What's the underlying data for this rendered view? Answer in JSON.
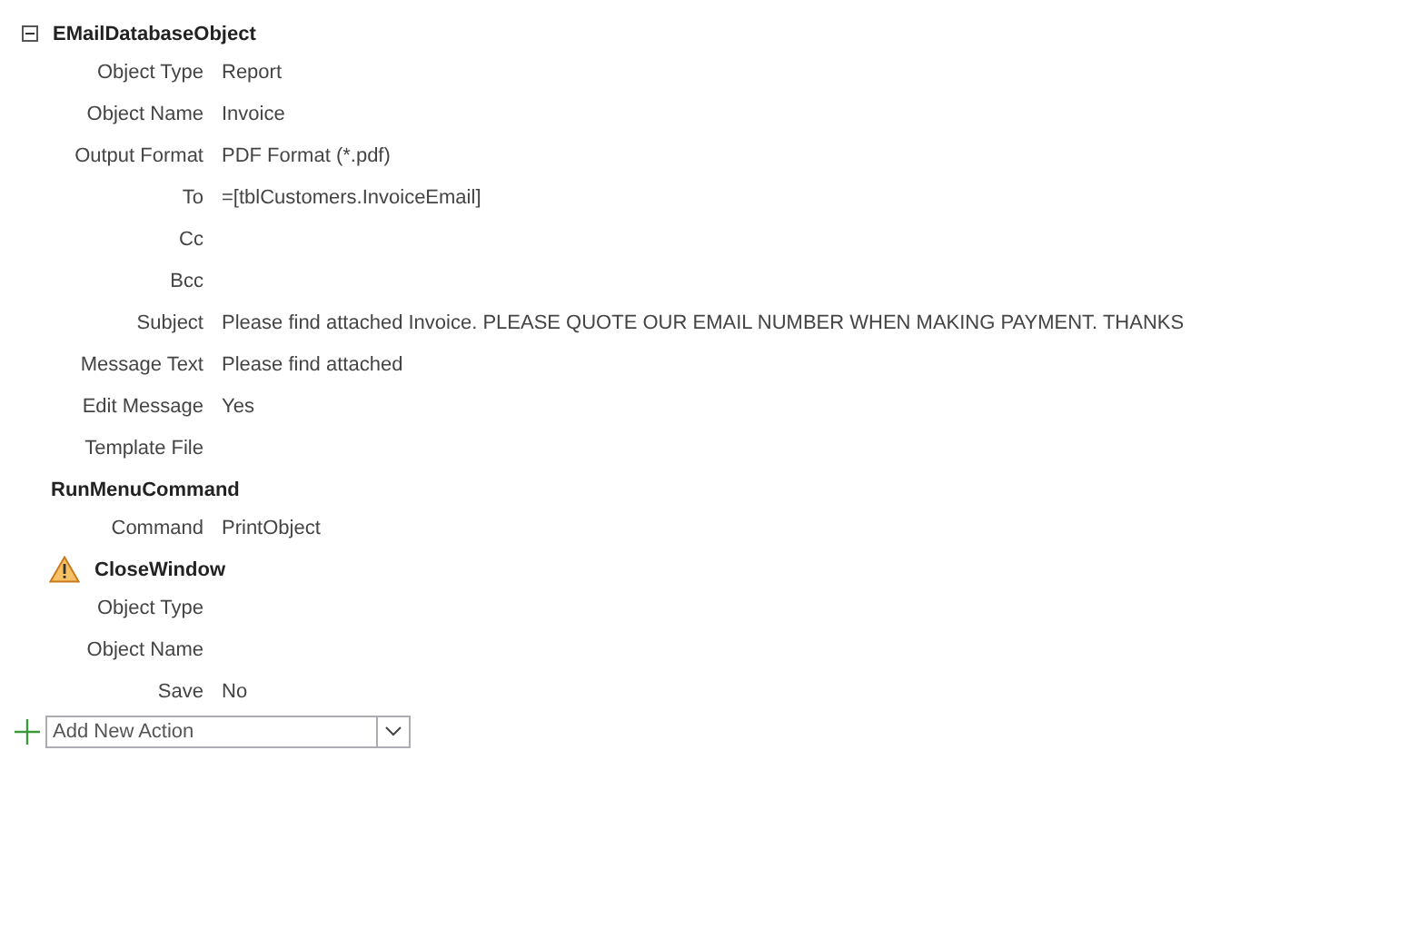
{
  "actions": [
    {
      "kind": "collapsible",
      "expanded": true,
      "name": "EMailDatabaseObject",
      "arguments": [
        {
          "label": "Object Type",
          "value": "Report"
        },
        {
          "label": "Object Name",
          "value": "Invoice"
        },
        {
          "label": "Output Format",
          "value": "PDF Format (*.pdf)"
        },
        {
          "label": "To",
          "value": "=[tblCustomers.InvoiceEmail]"
        },
        {
          "label": "Cc"
        },
        {
          "label": "Bcc"
        },
        {
          "label": "Subject",
          "value": "Please find attached Invoice. PLEASE QUOTE OUR EMAIL NUMBER WHEN MAKING PAYMENT. THANKS"
        },
        {
          "label": "Message Text",
          "value": "Please find attached"
        },
        {
          "label": "Edit Message",
          "value": "Yes"
        },
        {
          "label": "Template File"
        }
      ]
    },
    {
      "kind": "plain",
      "name": "RunMenuCommand",
      "arguments": [
        {
          "label": "Command",
          "value": "PrintObject"
        }
      ]
    },
    {
      "kind": "warning",
      "name": "CloseWindow",
      "arguments": [
        {
          "label": "Object Type"
        },
        {
          "label": "Object Name"
        },
        {
          "label": "Save",
          "value": "No"
        }
      ]
    }
  ],
  "add_action": {
    "placeholder": "Add New Action"
  }
}
